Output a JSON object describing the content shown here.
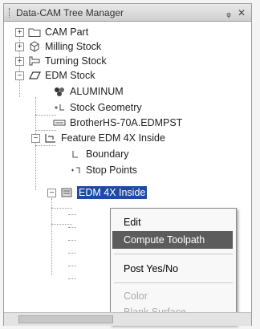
{
  "window": {
    "title": "Data-CAM Tree Manager",
    "controls": [
      "ᵩ",
      "✕"
    ]
  },
  "tree": {
    "items": [
      {
        "label": "CAM Part",
        "icon": "folder-icon",
        "expander": "+"
      },
      {
        "label": "Milling Stock",
        "icon": "milling-stock-icon",
        "expander": "+"
      },
      {
        "label": "Turning Stock",
        "icon": "turning-stock-icon",
        "expander": "+"
      },
      {
        "label": "EDM Stock",
        "icon": "edm-stock-icon",
        "expander": "−"
      },
      {
        "label": "ALUMINUM",
        "icon": "material-icon"
      },
      {
        "label": "Stock Geometry",
        "icon": "geometry-icon"
      },
      {
        "label": "BrotherHS-70A.EDMPST",
        "icon": "post-icon"
      },
      {
        "label": "Feature EDM 4X Inside",
        "icon": "feature-icon",
        "expander": "−"
      },
      {
        "label": "Boundary",
        "icon": "boundary-icon"
      },
      {
        "label": "Stop Points",
        "icon": "stop-points-icon"
      },
      {
        "label": "EDM 4X Inside",
        "icon": "operation-icon",
        "expander": "−",
        "selected": true
      }
    ]
  },
  "context_menu": {
    "items": [
      {
        "label": "Edit",
        "state": "normal"
      },
      {
        "label": "Compute Toolpath",
        "state": "highlight"
      },
      {
        "label": "Post Yes/No",
        "state": "normal"
      },
      {
        "label": "Color",
        "state": "disabled"
      },
      {
        "label": "Blank Surface",
        "state": "disabled"
      }
    ]
  }
}
